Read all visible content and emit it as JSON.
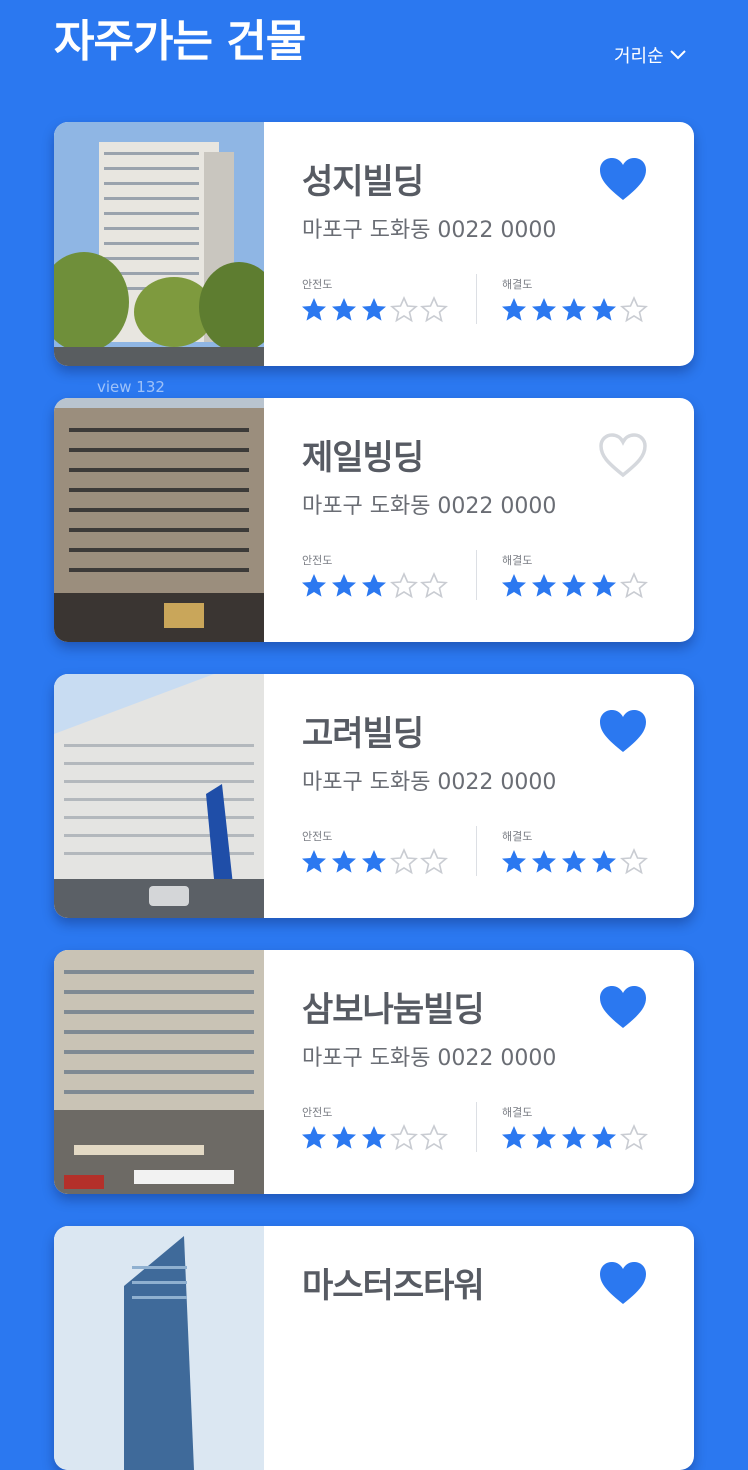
{
  "header": {
    "title": "자주가는 건물",
    "sort_label": "거리순",
    "sort_icon": "chevron-down-icon"
  },
  "view_count": "view 132",
  "rating_labels": {
    "safety": "안전도",
    "resolution": "해결도"
  },
  "colors": {
    "background": "#2b78f0",
    "accent": "#2b78f0",
    "star_empty": "#c9ccd2",
    "heart_empty": "#d5d8dd"
  },
  "buildings": [
    {
      "name": "성지빌딩",
      "address": "마포구 도화동 0022 0000",
      "favorite": true,
      "safety": 3,
      "resolution": 4
    },
    {
      "name": "제일빙딩",
      "address": "마포구 도화동 0022 0000",
      "favorite": false,
      "safety": 3,
      "resolution": 4
    },
    {
      "name": "고려빌딩",
      "address": "마포구 도화동 0022 0000",
      "favorite": true,
      "safety": 3,
      "resolution": 4
    },
    {
      "name": "삼보나눔빌딩",
      "address": "마포구 도화동 0022 0000",
      "favorite": true,
      "safety": 3,
      "resolution": 4
    },
    {
      "name": "마스터즈타워",
      "address": "",
      "favorite": true,
      "safety": 0,
      "resolution": 0
    }
  ]
}
